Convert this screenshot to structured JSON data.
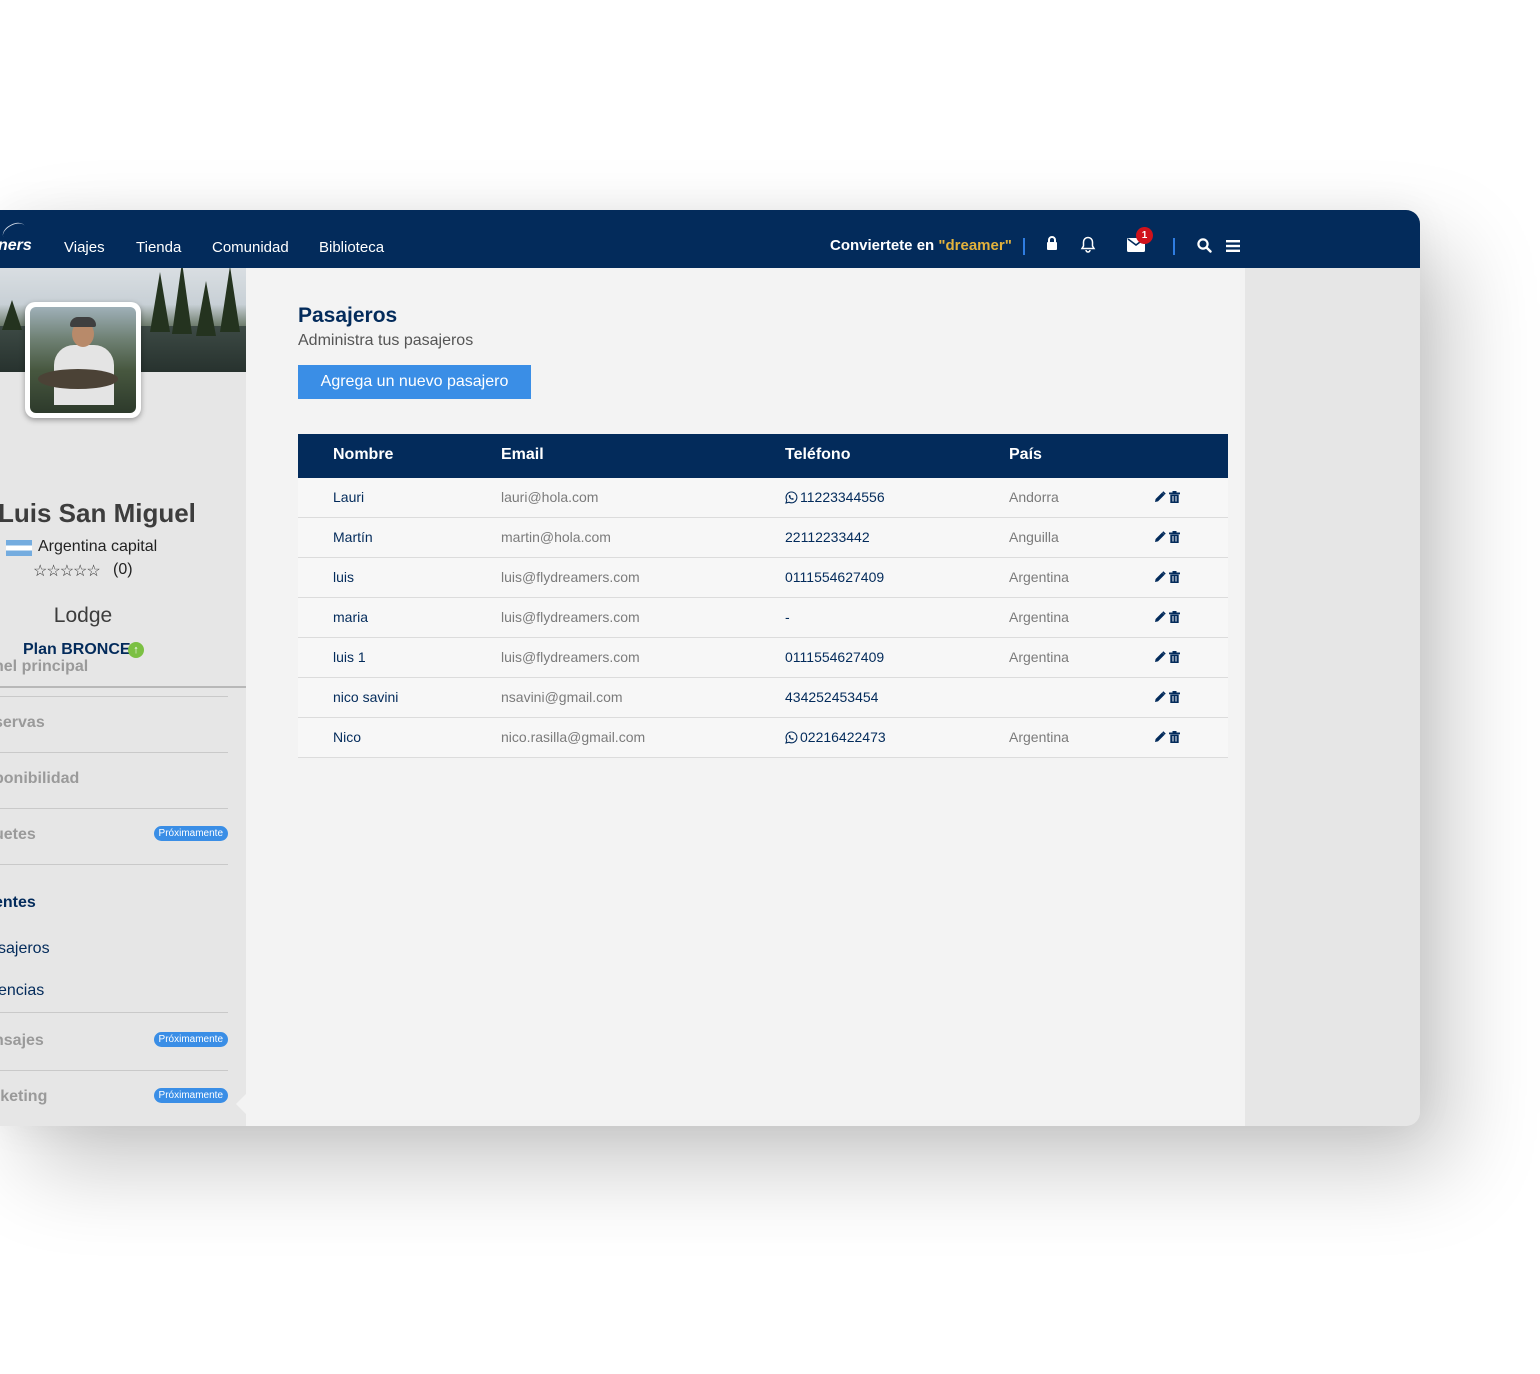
{
  "nav": {
    "logo_fragment": "ners",
    "links": [
      "Viajes",
      "Tienda",
      "Comunidad",
      "Biblioteca"
    ],
    "convert_prefix": "Conviertete en ",
    "convert_accent": "\"dreamer\"",
    "messages_badge": "1",
    "colors": {
      "background": "#032b5b",
      "accent": "#e3b23c",
      "badge": "#d0121b"
    }
  },
  "profile": {
    "name": "Luis San Miguel",
    "location": "Argentina capital",
    "stars": "☆☆☆☆☆",
    "rating_count": "(0)",
    "role": "Lodge",
    "plan": "Plan BRONCE",
    "plan_icon": "upgrade-arrow-icon"
  },
  "sidebar": {
    "items": [
      {
        "label": "nel principal",
        "badge": ""
      },
      {
        "label": "servas",
        "badge": ""
      },
      {
        "label": "ponibilidad",
        "badge": ""
      },
      {
        "label": "uetes",
        "badge": "Próximamente"
      }
    ],
    "active_section": "entes",
    "sub_items": [
      "sajeros",
      "encias"
    ],
    "bottom_items": [
      {
        "label": "nsajes",
        "badge": "Próximamente"
      },
      {
        "label": "rketing",
        "badge": "Próximamente"
      }
    ]
  },
  "page": {
    "title": "Pasajeros",
    "subtitle": "Administra tus pasajeros",
    "add_button": "Agrega un nuevo pasajero"
  },
  "table": {
    "headers": [
      "Nombre",
      "Email",
      "Teléfono",
      "País"
    ],
    "rows": [
      {
        "name": "Lauri",
        "email": "lauri@hola.com",
        "phone": "11223344556",
        "whatsapp": true,
        "country": "Andorra"
      },
      {
        "name": "Martín",
        "email": "martin@hola.com",
        "phone": "22112233442",
        "whatsapp": false,
        "country": "Anguilla"
      },
      {
        "name": "luis",
        "email": "luis@flydreamers.com",
        "phone": "0111554627409",
        "whatsapp": false,
        "country": "Argentina"
      },
      {
        "name": "maria",
        "email": "luis@flydreamers.com",
        "phone": "-",
        "whatsapp": false,
        "country": "Argentina"
      },
      {
        "name": "luis 1",
        "email": "luis@flydreamers.com",
        "phone": "0111554627409",
        "whatsapp": false,
        "country": "Argentina"
      },
      {
        "name": "nico savini",
        "email": "nsavini@gmail.com",
        "phone": "434252453454",
        "whatsapp": false,
        "country": ""
      },
      {
        "name": "Nico",
        "email": "nico.rasilla@gmail.com",
        "phone": "02216422473",
        "whatsapp": true,
        "country": "Argentina"
      }
    ]
  }
}
